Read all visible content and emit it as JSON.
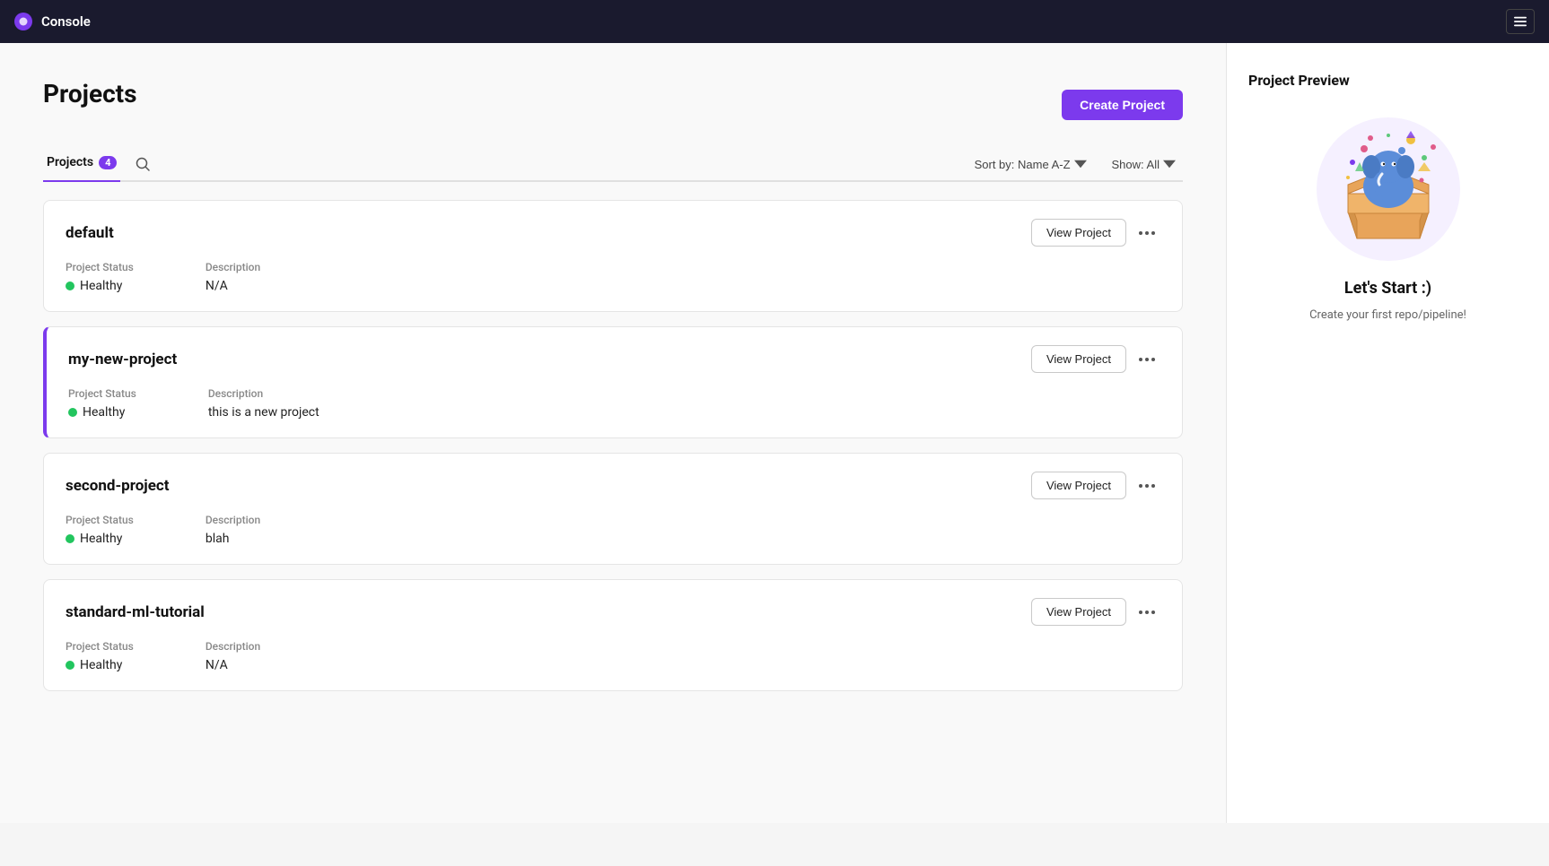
{
  "app": {
    "title": "Console",
    "logo_icon": "elephant-icon"
  },
  "topnav": {
    "title": "Console",
    "menu_label": "☰"
  },
  "header": {
    "page_title": "Projects",
    "create_button_label": "Create Project"
  },
  "tabs": [
    {
      "id": "projects",
      "label": "Projects",
      "badge": "4",
      "active": true
    },
    {
      "id": "search",
      "label": "",
      "icon": "search-icon"
    }
  ],
  "toolbar": {
    "sort_label": "Sort by: Name A-Z",
    "show_label": "Show: All"
  },
  "projects": [
    {
      "id": "default",
      "name": "default",
      "active_border": false,
      "status_label": "Project Status",
      "status_value": "Healthy",
      "description_label": "Description",
      "description_value": "N/A",
      "view_button_label": "View  Project"
    },
    {
      "id": "my-new-project",
      "name": "my-new-project",
      "active_border": true,
      "status_label": "Project Status",
      "status_value": "Healthy",
      "description_label": "Description",
      "description_value": "this is a new project",
      "view_button_label": "View  Project"
    },
    {
      "id": "second-project",
      "name": "second-project",
      "active_border": false,
      "status_label": "Project Status",
      "status_value": "Healthy",
      "description_label": "Description",
      "description_value": "blah",
      "view_button_label": "View  Project"
    },
    {
      "id": "standard-ml-tutorial",
      "name": "standard-ml-tutorial",
      "active_border": false,
      "status_label": "Project Status",
      "status_value": "Healthy",
      "description_label": "Description",
      "description_value": "N/A",
      "view_button_label": "View  Project"
    }
  ],
  "right_panel": {
    "title": "Project Preview",
    "cta_title": "Let's Start :)",
    "cta_desc": "Create your first repo/pipeline!"
  }
}
